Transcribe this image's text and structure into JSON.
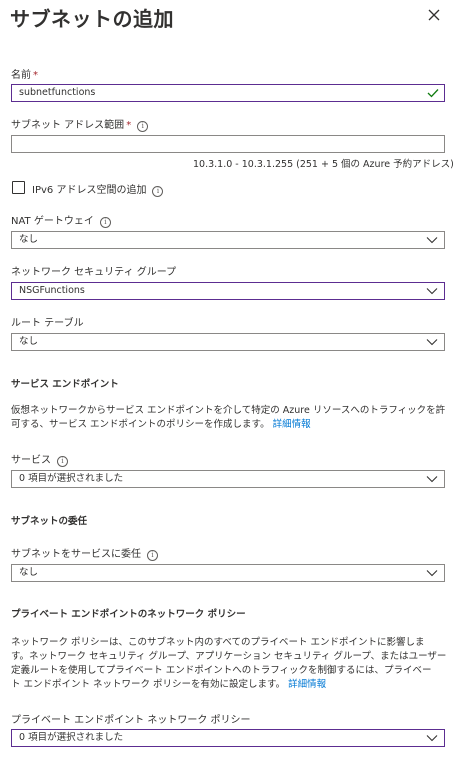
{
  "panel": {
    "title": "サブネットの追加"
  },
  "name": {
    "label": "名前",
    "required": "*",
    "value": "subnetfunctions"
  },
  "address_range": {
    "label": "サブネット アドレス範囲",
    "required": "*",
    "value": "",
    "hint": "10.3.1.0 - 10.3.1.255 (251 + 5 個の Azure 予約アドレス)"
  },
  "ipv6": {
    "label": "IPv6 アドレス空間の追加",
    "checked": false
  },
  "nat_gateway": {
    "label": "NAT ゲートウェイ",
    "value": "なし"
  },
  "nsg": {
    "label": "ネットワーク セキュリティ グループ",
    "value": "NSGFunctions"
  },
  "route_table": {
    "label": "ルート テーブル",
    "value": "なし"
  },
  "service_endpoints": {
    "heading": "サービス エンドポイント",
    "description_line1": "仮想ネットワークからサービス エンドポイントを介して特定の Azure リソースへのトラフィックを許",
    "description_line2": "可する、サービス エンドポイントのポリシーを作成します。",
    "link": "詳細情報",
    "services_label": "サービス",
    "services_value": "0 項目が選択されました"
  },
  "delegation": {
    "heading": "サブネットの委任",
    "label": "サブネットをサービスに委任",
    "value": "なし"
  },
  "private_endpoint": {
    "heading": "プライベート エンドポイントのネットワーク ポリシー",
    "description_line1": "ネットワーク ポリシーは、このサブネット内のすべてのプライベート エンドポイントに影響しま",
    "description_line2": "す。ネットワーク セキュリティ グループ、アプリケーション セキュリティ グループ、またはユーザー",
    "description_line3": "定義ルートを使用してプライベート エンドポイントへのトラフィックを制御するには、プライベー",
    "description_line4": "ト エンドポイント ネットワーク ポリシーを有効に設定します。",
    "link": "詳細情報",
    "policy_label": "プライベート エンドポイント ネットワーク ポリシー",
    "policy_value": "0 項目が選択されました"
  },
  "colors": {
    "focus_border": "#5c2d91",
    "valid_check": "#107c10",
    "link": "#0078d4",
    "required": "#a4262c"
  },
  "icons": {
    "close": "close-icon",
    "info": "info-icon",
    "chevron": "chevron-down-icon",
    "check": "check-icon"
  }
}
